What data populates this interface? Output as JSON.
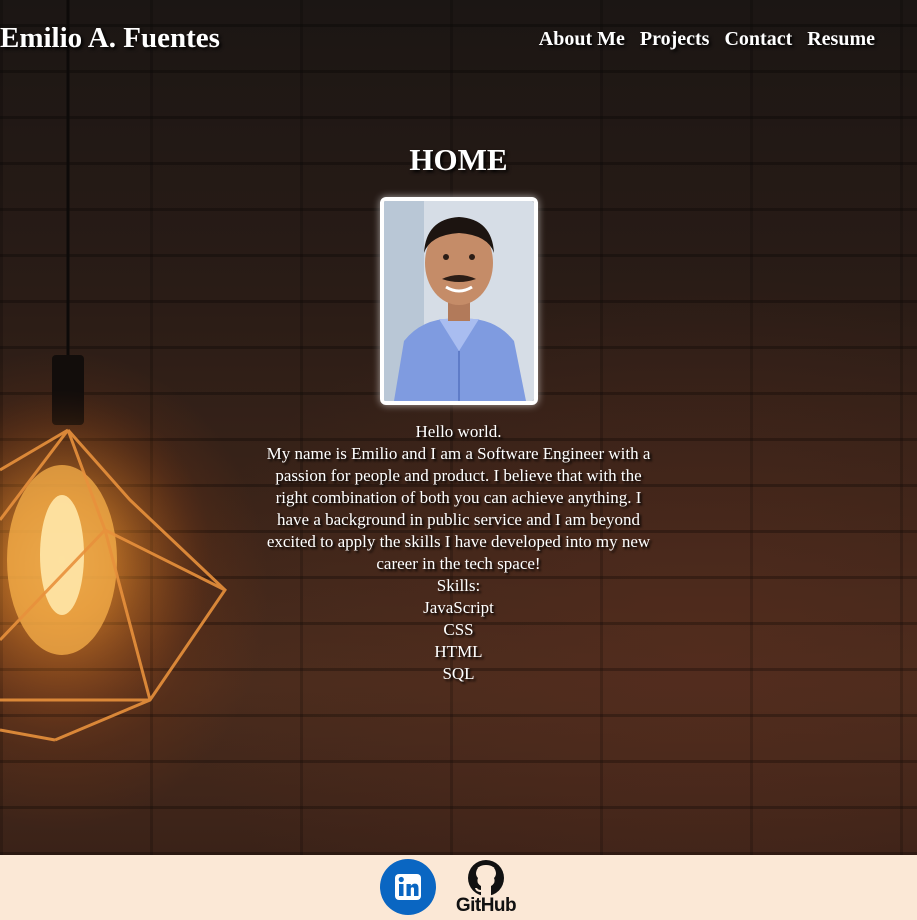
{
  "header": {
    "brand": "Emilio A. Fuentes",
    "nav": [
      "About Me",
      "Projects",
      "Contact",
      "Resume"
    ]
  },
  "main": {
    "title": "HOME",
    "greeting": "Hello world.",
    "bio": "My name is Emilio and I am a Software Engineer with a passion for people and product. I believe that with the right combination of both you can achieve anything. I have a background in public service and I am beyond excited to apply the skills I have developed into my new career in the tech space!",
    "skills_heading": "Skills:",
    "skills": [
      "JavaScript",
      "CSS",
      "HTML",
      "SQL"
    ]
  },
  "footer": {
    "github_label": "GitHub",
    "icons": [
      "linkedin-icon",
      "github-icon"
    ]
  },
  "colors": {
    "footer_bg": "#fbe8d6",
    "linkedin_blue": "#0a66c2",
    "text": "#ffffff"
  }
}
